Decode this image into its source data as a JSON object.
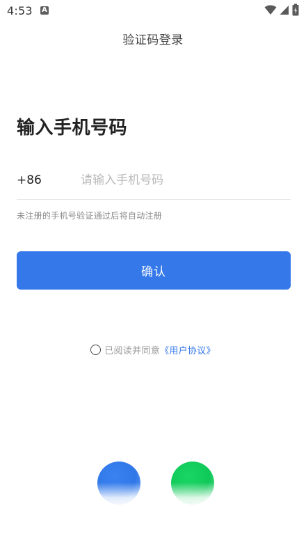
{
  "status_bar": {
    "time": "4:53",
    "notification_icon": "a-icon",
    "icons": [
      "wifi-icon",
      "signal-icon",
      "battery-icon"
    ]
  },
  "header": {
    "title": "验证码登录"
  },
  "main": {
    "title": "输入手机号码",
    "country_code": "+86",
    "phone_placeholder": "请输入手机号码",
    "phone_value": "",
    "hint": "未注册的手机号验证通过后将自动注册",
    "confirm_label": "确认"
  },
  "agreement": {
    "checked": false,
    "text": "已阅读并同意",
    "link_text": "《用户协议》"
  },
  "social_login": {
    "buttons": [
      {
        "name": "blue-login-button",
        "color": "#2f77e8"
      },
      {
        "name": "green-login-button",
        "color": "#0fc858"
      }
    ]
  },
  "colors": {
    "accent": "#3478ea",
    "link": "#3478ea",
    "background": "#ffffff"
  }
}
